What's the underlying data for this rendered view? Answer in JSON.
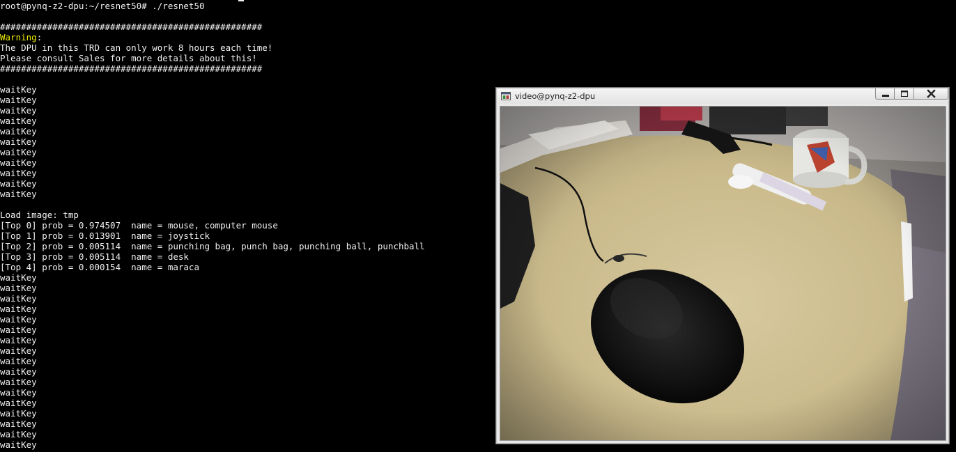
{
  "terminal": {
    "prompt_line": "root@pynq-z2-dpu:~/resnet50# ./resnet50",
    "hash_rule": "##################################################",
    "warning_label": "Warning",
    "warning_colon": ":",
    "warning_line1": "The DPU in this TRD can only work 8 hours each time!",
    "warning_line2": "Please consult Sales for more details about this!",
    "waitkey_first": [
      "waitKey",
      "waitKey",
      "waitKey",
      "waitKey",
      "waitKey",
      "waitKey",
      "waitKey",
      "waitKey",
      "waitKey",
      "waitKey",
      "waitKey"
    ],
    "load_image": "Load image: tmp",
    "results": [
      "[Top 0] prob = 0.974507  name = mouse, computer mouse",
      "[Top 1] prob = 0.013901  name = joystick",
      "[Top 2] prob = 0.005114  name = punching bag, punch bag, punching ball, punchball",
      "[Top 3] prob = 0.005114  name = desk",
      "[Top 4] prob = 0.000154  name = maraca"
    ],
    "waitkey_second": [
      "waitKey",
      "waitKey",
      "waitKey",
      "waitKey",
      "waitKey",
      "waitKey",
      "waitKey",
      "waitKey",
      "waitKey",
      "waitKey",
      "waitKey",
      "waitKey",
      "waitKey",
      "waitKey",
      "waitKey",
      "waitKey",
      "waitKey"
    ],
    "colors": {
      "background": "#000000",
      "text": "#f0f0f0",
      "warning": "#f0f000"
    }
  },
  "video_window": {
    "title": "video@pynq-z2-dpu",
    "icons": {
      "app": "app-window-icon",
      "minimize": "minimize-icon",
      "maximize": "maximize-icon",
      "close": "close-icon"
    }
  }
}
